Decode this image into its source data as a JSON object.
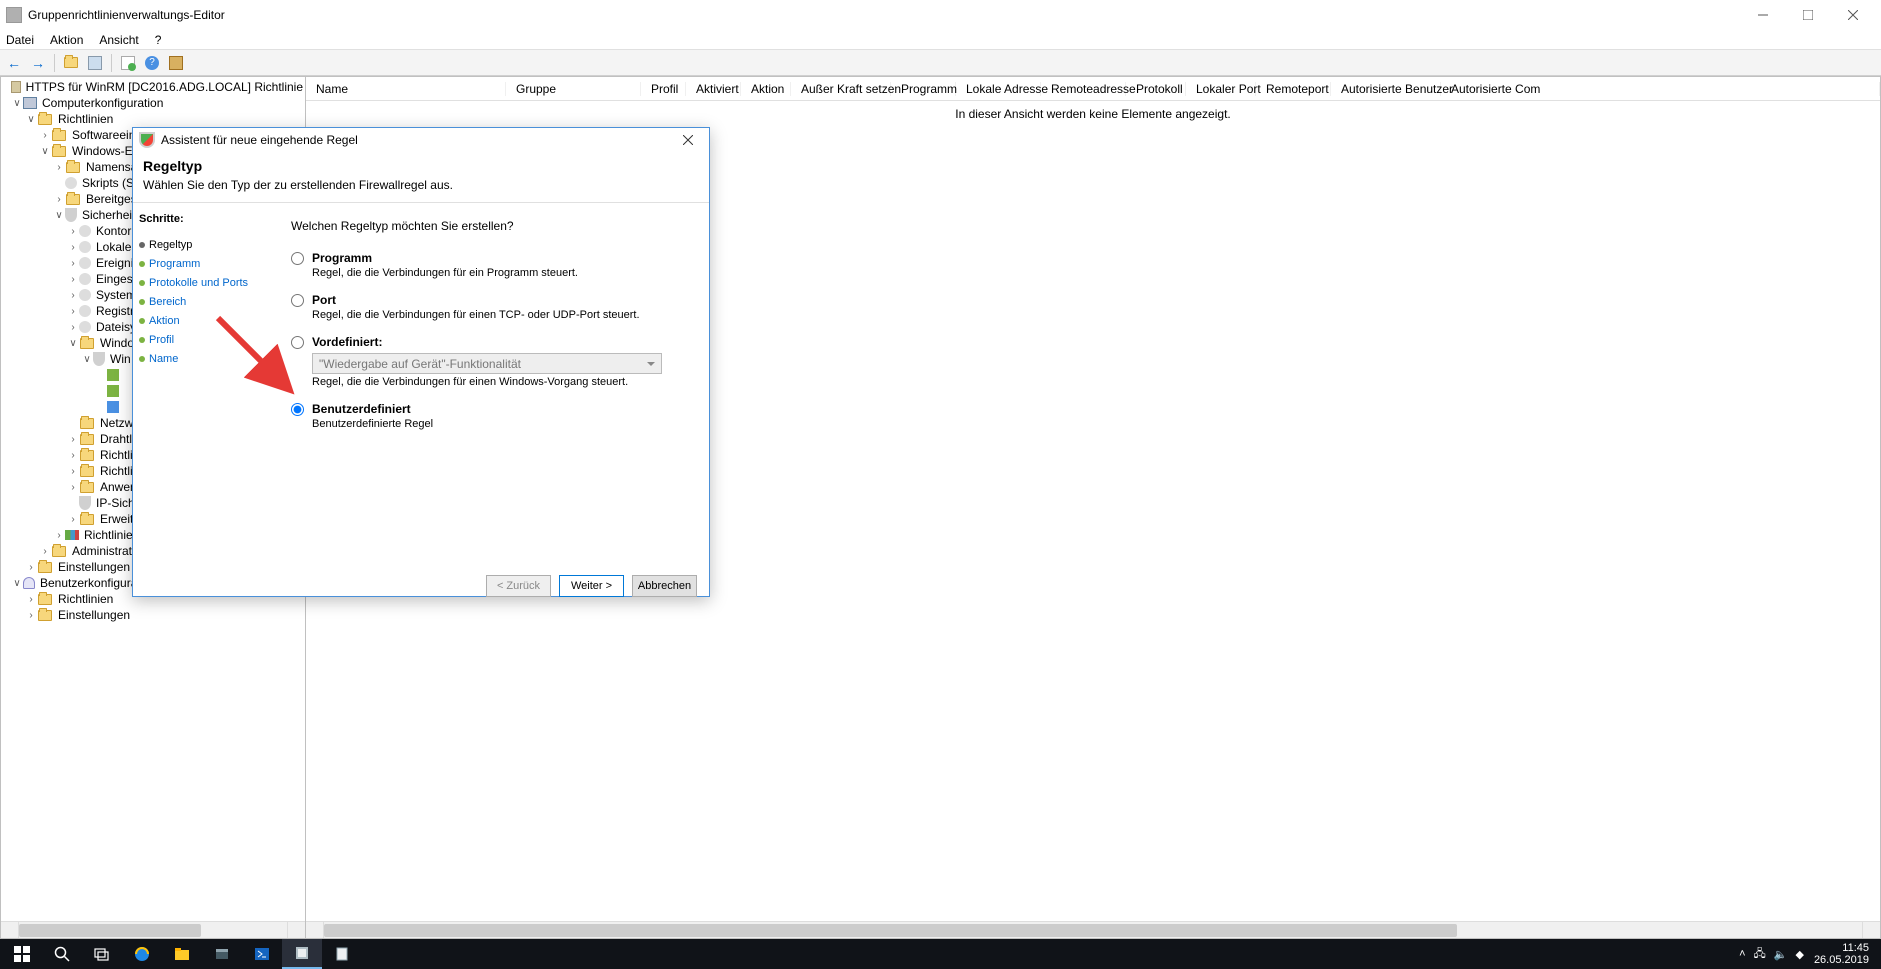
{
  "window": {
    "title": "Gruppenrichtlinienverwaltungs-Editor"
  },
  "menu": {
    "file": "Datei",
    "action": "Aktion",
    "view": "Ansicht",
    "help": "?"
  },
  "tree": {
    "root": "HTTPS für WinRM [DC2016.ADG.LOCAL] Richtlinie",
    "computerconf": "Computerkonfiguration",
    "policies": "Richtlinien",
    "softwaresettings": "Softwareeinstellungen",
    "windowseins": "Windows-Eins",
    "names": "Namensau",
    "scripts": "Skripts (Sta",
    "bereit": "Bereitgeste",
    "security": "Sicherheits",
    "konto": "Kontori",
    "lokale": "Lokale",
    "ereignis": "Ereignis",
    "einge": "Eingesc",
    "system": "System",
    "regist": "Registr",
    "dateisy": "Dateisy",
    "windowsnode": "Windo",
    "win": "Win",
    "netzwe": "Netzwe",
    "drahtlo": "Drahtlo",
    "richtlin1": "Richtlin",
    "richtlin2": "Richtlin",
    "anwen": "Anwen",
    "ipsich": "IP-Sich",
    "erweite": "Erweite",
    "richtlinienbar": "Richtlinien",
    "admvorl": "Administrative",
    "einstellungen": "Einstellungen",
    "userconf": "Benutzerkonfiguration",
    "richtlinien2": "Richtlinien",
    "einstellungen2": "Einstellungen"
  },
  "columns": [
    "Name",
    "Gruppe",
    "Profil",
    "Aktiviert",
    "Aktion",
    "Außer Kraft setzen",
    "Programm",
    "Lokale Adresse",
    "Remoteadresse",
    "Protokoll",
    "Lokaler Port",
    "Remoteport",
    "Autorisierte Benutzer",
    "Autorisierte Com"
  ],
  "list": {
    "empty": "In dieser Ansicht werden keine Elemente angezeigt."
  },
  "dialog": {
    "title": "Assistent für neue eingehende Regel",
    "heading": "Regeltyp",
    "subheading": "Wählen Sie den Typ der zu erstellenden Firewallregel aus.",
    "steps_label": "Schritte:",
    "steps": [
      "Regeltyp",
      "Programm",
      "Protokolle und Ports",
      "Bereich",
      "Aktion",
      "Profil",
      "Name"
    ],
    "question": "Welchen Regeltyp möchten Sie erstellen?",
    "opt_program": {
      "label": "Programm",
      "desc": "Regel, die die Verbindungen für ein Programm steuert."
    },
    "opt_port": {
      "label": "Port",
      "desc": "Regel, die die Verbindungen für einen TCP- oder UDP-Port steuert."
    },
    "opt_predef": {
      "label": "Vordefiniert:",
      "combo": "\"Wiedergabe auf Gerät\"-Funktionalität",
      "desc": "Regel, die die Verbindungen für einen Windows-Vorgang steuert."
    },
    "opt_custom": {
      "label": "Benutzerdefiniert",
      "desc": "Benutzerdefinierte Regel"
    },
    "btn_back": "< Zurück",
    "btn_next": "Weiter >",
    "btn_cancel": "Abbrechen"
  },
  "taskbar": {
    "time": "11:45",
    "date": "26.05.2019"
  }
}
